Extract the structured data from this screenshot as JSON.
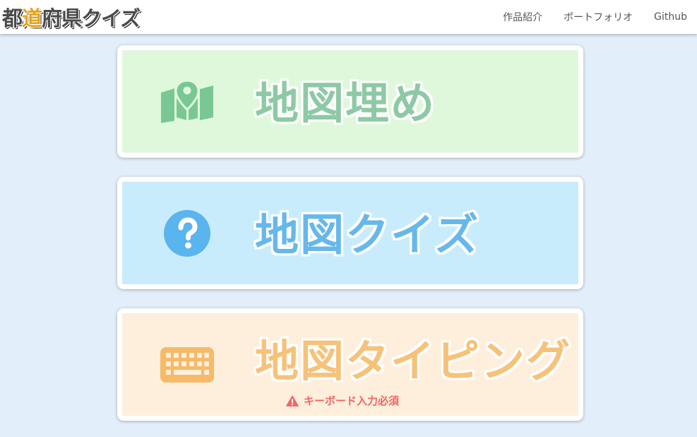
{
  "header": {
    "logo": {
      "part1": "都",
      "accent": "道",
      "part2": "府県クイズ"
    },
    "nav": [
      {
        "label": "作品紹介"
      },
      {
        "label": "ポートフォリオ"
      },
      {
        "label": "Github"
      }
    ]
  },
  "cards": [
    {
      "title": "地図埋め",
      "icon": "map-location-icon",
      "bg_color": "#dff8dc",
      "text_color": "#8ec9a6",
      "icon_color": "#79c893"
    },
    {
      "title": "地図クイズ",
      "icon": "question-circle-icon",
      "bg_color": "#c9ecfc",
      "text_color": "#67b8ea",
      "icon_color": "#5ab4ee"
    },
    {
      "title": "地図タイピング",
      "icon": "keyboard-icon",
      "bg_color": "#fdefdb",
      "text_color": "#f6c27a",
      "icon_color": "#f6ba68",
      "warning": {
        "icon": "warning-triangle-icon",
        "text": "キーボード入力必須",
        "color": "#f06666"
      }
    }
  ]
}
